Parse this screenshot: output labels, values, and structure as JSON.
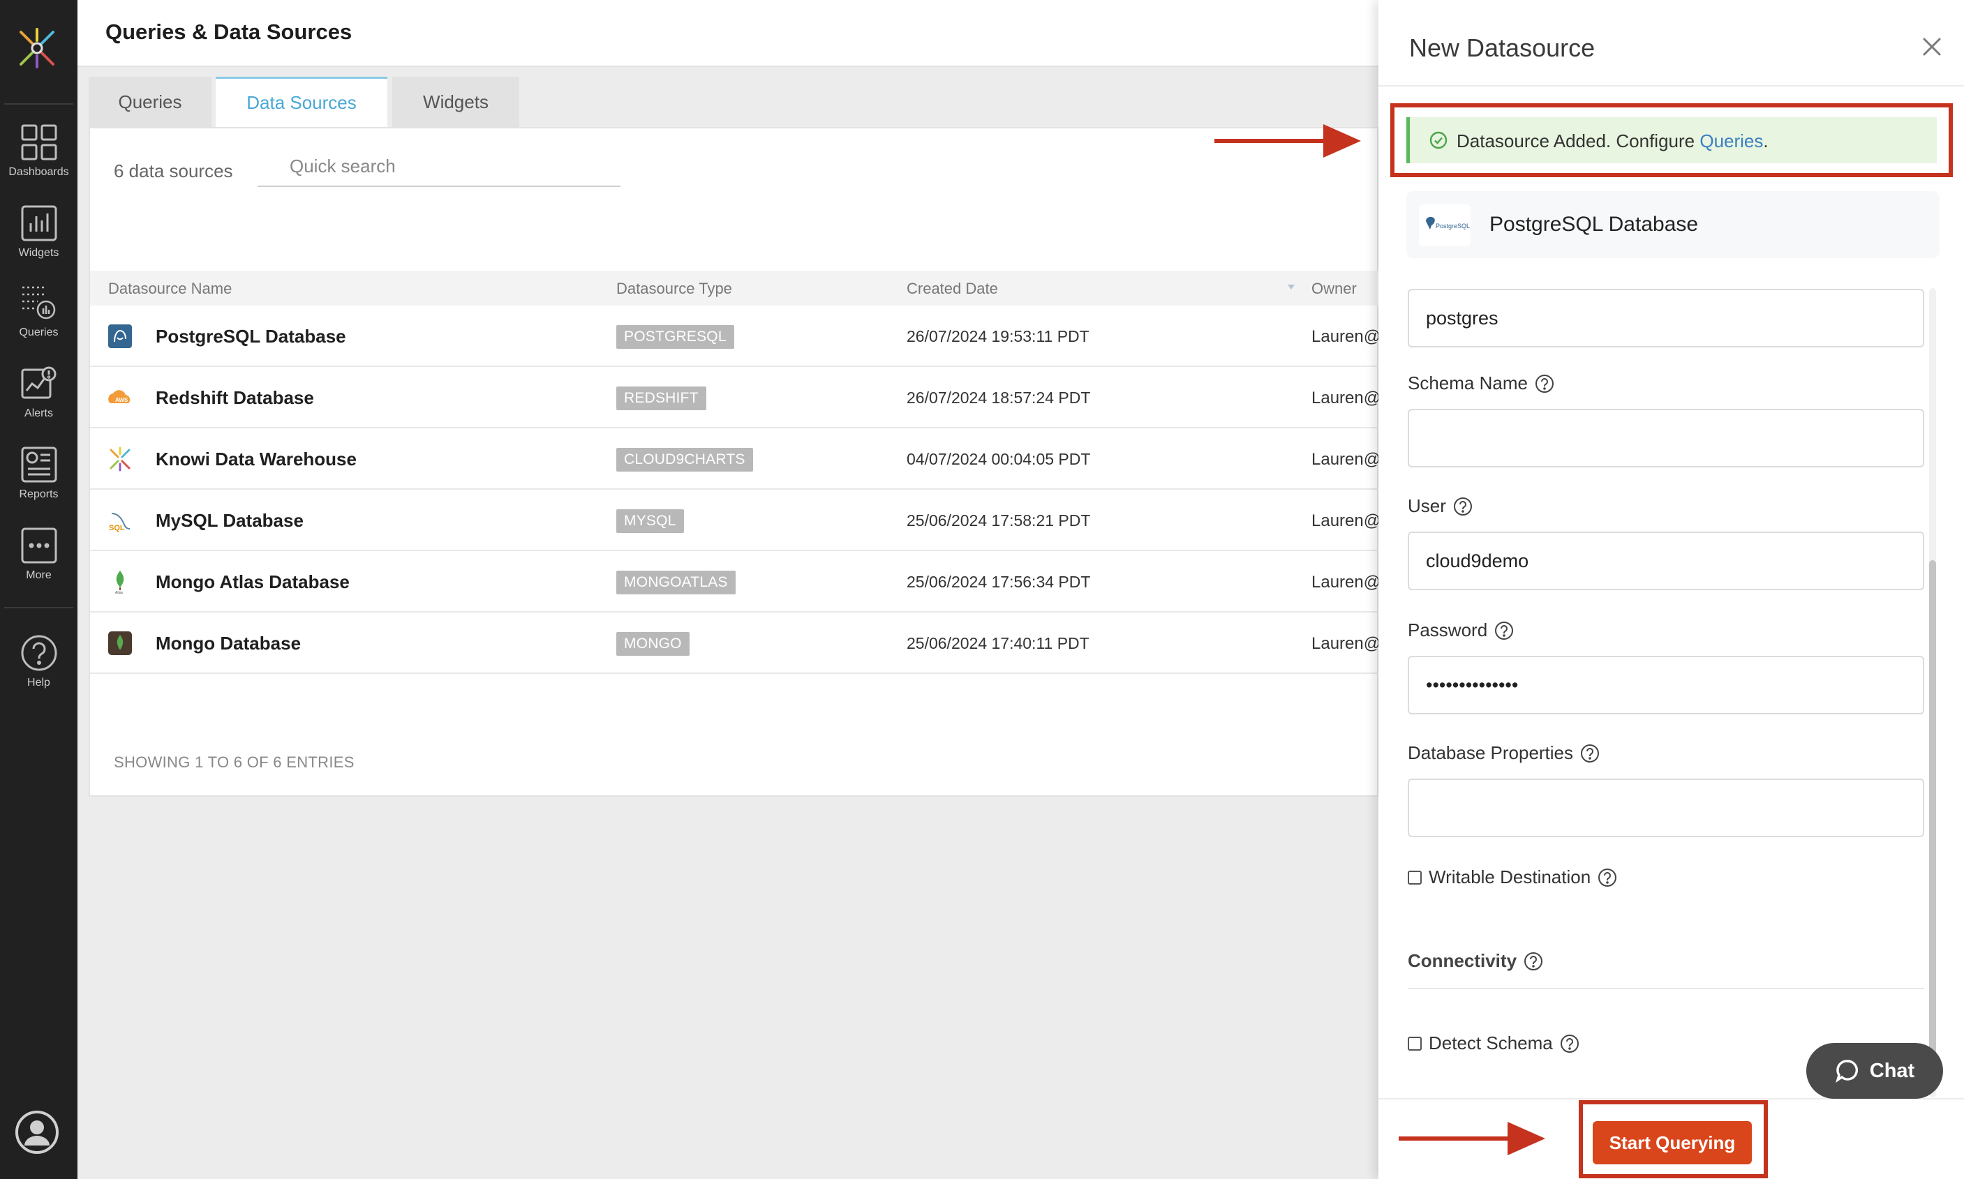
{
  "app": {
    "page_title": "Queries & Data Sources"
  },
  "sidebar": {
    "items": [
      {
        "label": "Dashboards",
        "icon": "dashboards-icon"
      },
      {
        "label": "Widgets",
        "icon": "widgets-icon"
      },
      {
        "label": "Queries",
        "icon": "queries-icon"
      },
      {
        "label": "Alerts",
        "icon": "alerts-icon"
      },
      {
        "label": "Reports",
        "icon": "reports-icon"
      },
      {
        "label": "More",
        "icon": "more-icon"
      },
      {
        "label": "Help",
        "icon": "help-icon"
      }
    ]
  },
  "tabs": [
    {
      "label": "Queries"
    },
    {
      "label": "Data Sources",
      "active": true
    },
    {
      "label": "Widgets"
    }
  ],
  "list": {
    "count_text": "6 data sources",
    "search_placeholder": "Quick search",
    "columns": [
      "Datasource Name",
      "Datasource Type",
      "Created Date",
      "Owner"
    ],
    "rows": [
      {
        "name": "PostgreSQL Database",
        "type": "POSTGRESQL",
        "created": "26/07/2024 19:53:11 PDT",
        "owner": "Lauren@",
        "icon": "postgresql-icon"
      },
      {
        "name": "Redshift Database",
        "type": "REDSHIFT",
        "created": "26/07/2024 18:57:24 PDT",
        "owner": "Lauren@",
        "icon": "aws-icon"
      },
      {
        "name": "Knowi Data Warehouse",
        "type": "CLOUD9CHARTS",
        "created": "04/07/2024 00:04:05 PDT",
        "owner": "Lauren@",
        "icon": "knowi-icon"
      },
      {
        "name": "MySQL Database",
        "type": "MYSQL",
        "created": "25/06/2024 17:58:21 PDT",
        "owner": "Lauren@",
        "icon": "mysql-icon"
      },
      {
        "name": "Mongo Atlas Database",
        "type": "MONGOATLAS",
        "created": "25/06/2024 17:56:34 PDT",
        "owner": "Lauren@",
        "icon": "mongo-atlas-icon"
      },
      {
        "name": "Mongo Database",
        "type": "MONGO",
        "created": "25/06/2024 17:40:11 PDT",
        "owner": "Lauren@",
        "icon": "mongo-icon"
      }
    ],
    "entries_text": "SHOWING 1 TO 6 OF 6 ENTRIES"
  },
  "drawer": {
    "title": "New Datasource",
    "success_text": "Datasource Added. Configure ",
    "success_link": "Queries",
    "success_end": ".",
    "datasource_name": "PostgreSQL Database",
    "logo_text": "PostgreSQL",
    "database_value": "postgres",
    "schema_label": "Schema Name",
    "schema_value": "",
    "user_label": "User",
    "user_value": "cloud9demo",
    "password_label": "Password",
    "password_value": "••••••••••••••",
    "db_props_label": "Database Properties",
    "db_props_value": "",
    "writable_label": "Writable Destination",
    "connectivity_label": "Connectivity",
    "detect_schema_label": "Detect Schema",
    "start_button": "Start Querying"
  },
  "chat": {
    "label": "Chat"
  },
  "colors": {
    "accent_orange": "#d9461c",
    "annotation_red": "#c5321e",
    "tab_active": "#4aa8d6",
    "success_bg": "#e8f5e0",
    "sidebar_bg": "#212121"
  }
}
